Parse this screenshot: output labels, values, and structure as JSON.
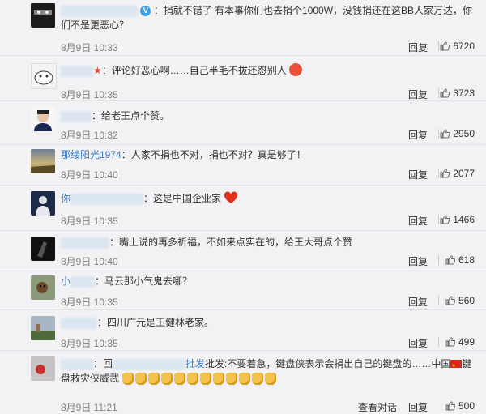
{
  "colors": {
    "username": "#eb7350",
    "time": "#808080",
    "text": "#333333",
    "bg": "#f2f2f5"
  },
  "comments": [
    {
      "name": "",
      "text": "：捐就不错了 有本事你们也去捐个1000W，没钱捐还在这BB人家万达，你们不是更恶心？",
      "time": "8月9日 10:33",
      "reply": "回复",
      "likes": "6720"
    },
    {
      "name": "",
      "text": "：评论好恶心啊……自己半毛不拔还怼别人",
      "time": "8月9日 10:35",
      "reply": "回复",
      "likes": "3723"
    },
    {
      "name": "",
      "text": "：给老王点个赞。",
      "time": "8月9日 10:32",
      "reply": "回复",
      "likes": "2950"
    },
    {
      "name": "那缕阳光1974",
      "text": "：人家不捐也不对，捐也不对？真是够了！",
      "time": "8月9日 10:40",
      "reply": "回复",
      "likes": "2077"
    },
    {
      "name": "你",
      "text": "：这是中国企业家",
      "time": "8月9日 10:35",
      "reply": "回复",
      "likes": "1466"
    },
    {
      "name": "",
      "text": "：嘴上说的再多祈福，不如来点实在的，给王大哥点个赞",
      "time": "8月9日 10:40",
      "reply": "回复",
      "likes": "618"
    },
    {
      "name": "小",
      "text": "：马云那小气鬼去哪？",
      "time": "8月9日 10:35",
      "reply": "回复",
      "likes": "560"
    },
    {
      "name": "",
      "text": "：四川广元是王健林老家。",
      "time": "8月9日 10:35",
      "reply": "回复",
      "likes": "499"
    },
    {
      "name": "",
      "text": "：回",
      "text2": "批发:不要着急，键盘侠表示会捐出自己的键盘的……中国",
      "text3": "键盘救灾侠威武",
      "time": "8月9日 11:21",
      "reply": "查看对话",
      "reply2": "回复",
      "likes": "500"
    }
  ]
}
